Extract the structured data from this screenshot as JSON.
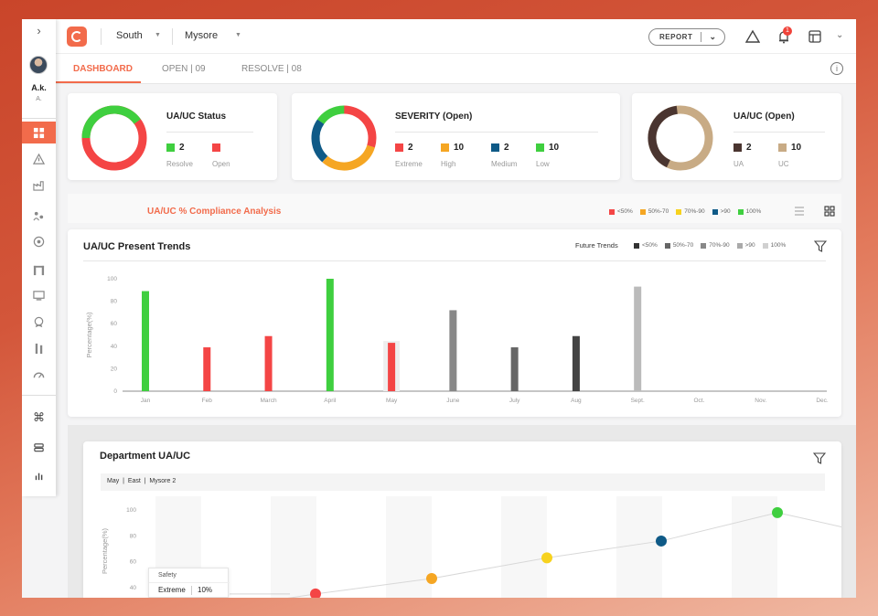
{
  "sidebar": {
    "toggle_icon": "chevron-right-icon",
    "user_name": "A.k.",
    "user_sub": "A.",
    "items": [
      {
        "icon": "dashboard-grid-icon",
        "active": true
      },
      {
        "icon": "warning-zone-icon"
      },
      {
        "icon": "factory-icon"
      },
      {
        "icon": "people-icon"
      },
      {
        "icon": "target-icon"
      },
      {
        "icon": "gate-icon"
      },
      {
        "icon": "monitor-icon"
      },
      {
        "icon": "badge-icon"
      },
      {
        "icon": "tools-icon"
      },
      {
        "icon": "gauge-icon"
      },
      {
        "icon": "command-icon"
      },
      {
        "icon": "stack-icon"
      },
      {
        "icon": "bar-chart-icon"
      }
    ]
  },
  "topbar": {
    "region": "South",
    "city": "Mysore",
    "report_label": "REPORT",
    "notification_count": "1",
    "accent": "#f26b4b"
  },
  "tabs": [
    {
      "label": "DASHBOARD",
      "active": true
    },
    {
      "label": "OPEN | 09"
    },
    {
      "label": "RESOLVE | 08"
    }
  ],
  "cards": {
    "status": {
      "title": "UA/UC Status",
      "items": [
        {
          "value": "2",
          "label": "Resolve",
          "color": "#3fcf3f"
        },
        {
          "value": "",
          "label": "Open",
          "color": "#f44545"
        }
      ]
    },
    "severity": {
      "title": "SEVERITY (Open)",
      "items": [
        {
          "value": "2",
          "label": "Extreme",
          "color": "#f44545"
        },
        {
          "value": "10",
          "label": "High",
          "color": "#f5a623"
        },
        {
          "value": "2",
          "label": "Medium",
          "color": "#0f5a87"
        },
        {
          "value": "10",
          "label": "Low",
          "color": "#3fcf3f"
        }
      ]
    },
    "uauc": {
      "title": "UA/UC (Open)",
      "items": [
        {
          "value": "2",
          "label": "UA",
          "color": "#4a3530"
        },
        {
          "value": "10",
          "label": "UC",
          "color": "#c8ab85"
        }
      ]
    }
  },
  "compliance": {
    "title": "UA/UC % Compliance Analysis",
    "legend": [
      {
        "label": "<50%",
        "color": "#f44545"
      },
      {
        "label": "50%-70",
        "color": "#f5a623"
      },
      {
        "label": "70%-90",
        "color": "#f7d21e"
      },
      {
        "label": ">90",
        "color": "#0f5a87"
      },
      {
        "label": "100%",
        "color": "#3fcf3f"
      }
    ]
  },
  "trends": {
    "title": "UA/UC Present Trends",
    "future_label": "Future Trends",
    "future_legend": [
      {
        "label": "<50%",
        "color": "#333333"
      },
      {
        "label": "50%-70",
        "color": "#666666"
      },
      {
        "label": "70%-90",
        "color": "#888888"
      },
      {
        "label": ">90",
        "color": "#aaaaaa"
      },
      {
        "label": "100%",
        "color": "#d0d0d0"
      }
    ]
  },
  "department": {
    "title": "Department UA/UC",
    "filter_crumb": "May  |  East  |  Mysore 2",
    "tooltip_title": "Safety",
    "tooltip_key": "Extreme",
    "tooltip_val": "10%"
  },
  "chart_data": [
    {
      "type": "bar",
      "title": "UA/UC Present Trends",
      "ylabel": "Percentage(%)",
      "ylim": [
        0,
        100
      ],
      "yticks": [
        0,
        20,
        40,
        60,
        80,
        100
      ],
      "categories": [
        "Jan",
        "Feb",
        "March",
        "April",
        "May",
        "June",
        "July",
        "Aug",
        "Sept.",
        "Oct.",
        "Nov.",
        "Dec."
      ],
      "values": [
        89,
        39,
        49,
        100,
        43,
        72,
        39,
        49,
        93,
        null,
        null,
        null
      ],
      "colors": [
        "#3fcf3f",
        "#f44545",
        "#f44545",
        "#3fcf3f",
        "#f44545",
        "#888888",
        "#666666",
        "#444444",
        "#bbbbbb",
        null,
        null,
        null
      ]
    },
    {
      "type": "line",
      "title": "Department UA/UC",
      "ylabel": "Percentage(%)",
      "ylim": [
        0,
        100
      ],
      "yticks": [
        40,
        60,
        80,
        100
      ],
      "x": [
        1,
        2,
        3,
        4,
        5,
        6
      ],
      "values": [
        35,
        47,
        63,
        76,
        98,
        86
      ],
      "point_colors": [
        "#f44545",
        "#f5a623",
        "#f7d21e",
        "#0f5a87",
        "#3fcf3f",
        null
      ]
    }
  ]
}
